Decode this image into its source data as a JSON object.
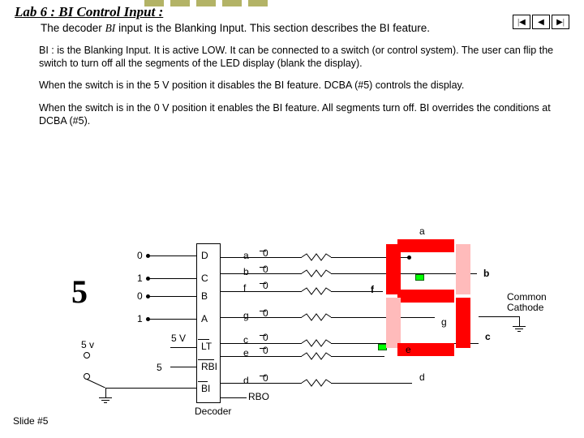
{
  "title": "Lab 6 : BI Control Input :",
  "subtitle_pre": "The decoder ",
  "subtitle_bi": "BI",
  "subtitle_post": " input is the Blanking Input. This section describes the BI feature.",
  "para1": "BI : is the Blanking Input. It is active LOW. It can be connected to a switch (or control system). The user can flip the switch to turn off all the segments of the LED display (blank the display).",
  "para2": "When the switch is in the 5 V position it disables the BI feature. DCBA (#5) controls the display.",
  "para3": "When the switch is in the 0 V position it enables the BI feature. All segments turn off. BI overrides the conditions at DCBA (#5).",
  "digit": "5",
  "inputs": [
    {
      "bit": "0",
      "pin": "D"
    },
    {
      "bit": "1",
      "pin": "C"
    },
    {
      "bit": "0",
      "pin": "B"
    },
    {
      "bit": "1",
      "pin": "A"
    }
  ],
  "control": {
    "v5": "5 V",
    "lt": "LT",
    "rbi": "RBI",
    "bi": "BI"
  },
  "source": "5 v",
  "five": "5",
  "outputs": [
    {
      "seg": "a",
      "val": "0"
    },
    {
      "seg": "b",
      "val": "0"
    },
    {
      "seg": "f",
      "val": "0"
    },
    {
      "seg": "g",
      "val": "0"
    },
    {
      "seg": "c",
      "val": "0"
    },
    {
      "seg": "e",
      "val": "0"
    },
    {
      "seg": "d",
      "val": "0"
    }
  ],
  "rbo": "RBO",
  "seg_labels": {
    "a": "a",
    "b": "b",
    "c": "c",
    "d": "d",
    "e": "e",
    "f": "f",
    "g": "g"
  },
  "common": "Common Cathode",
  "decoder": "Decoder",
  "slide": "Slide #5"
}
